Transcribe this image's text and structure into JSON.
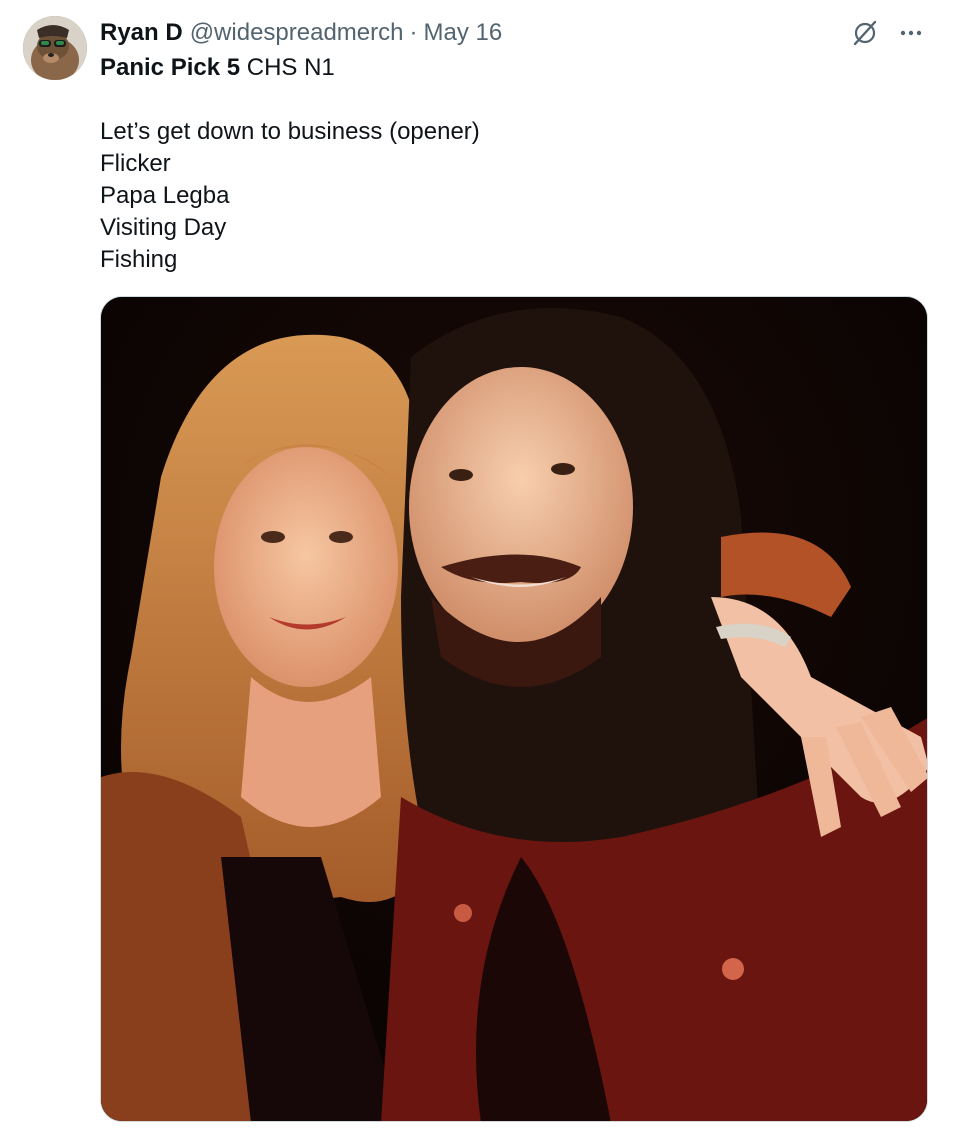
{
  "tweet": {
    "author": {
      "name": "Ryan D",
      "handle": "@widespreadmerch"
    },
    "separator": "·",
    "date": "May 16",
    "title_bold": "Panic Pick 5",
    "title_rest": " CHS N1",
    "lines": [
      "Let’s get down to business (opener)",
      "Flicker",
      "Papa Legba",
      "Visiting Day",
      "Fishing"
    ],
    "icons": {
      "grok": "grok-icon",
      "more": "more-options-icon"
    },
    "media": {
      "type": "photo"
    },
    "colors": {
      "text": "#0f1419",
      "secondary": "#536471"
    }
  }
}
